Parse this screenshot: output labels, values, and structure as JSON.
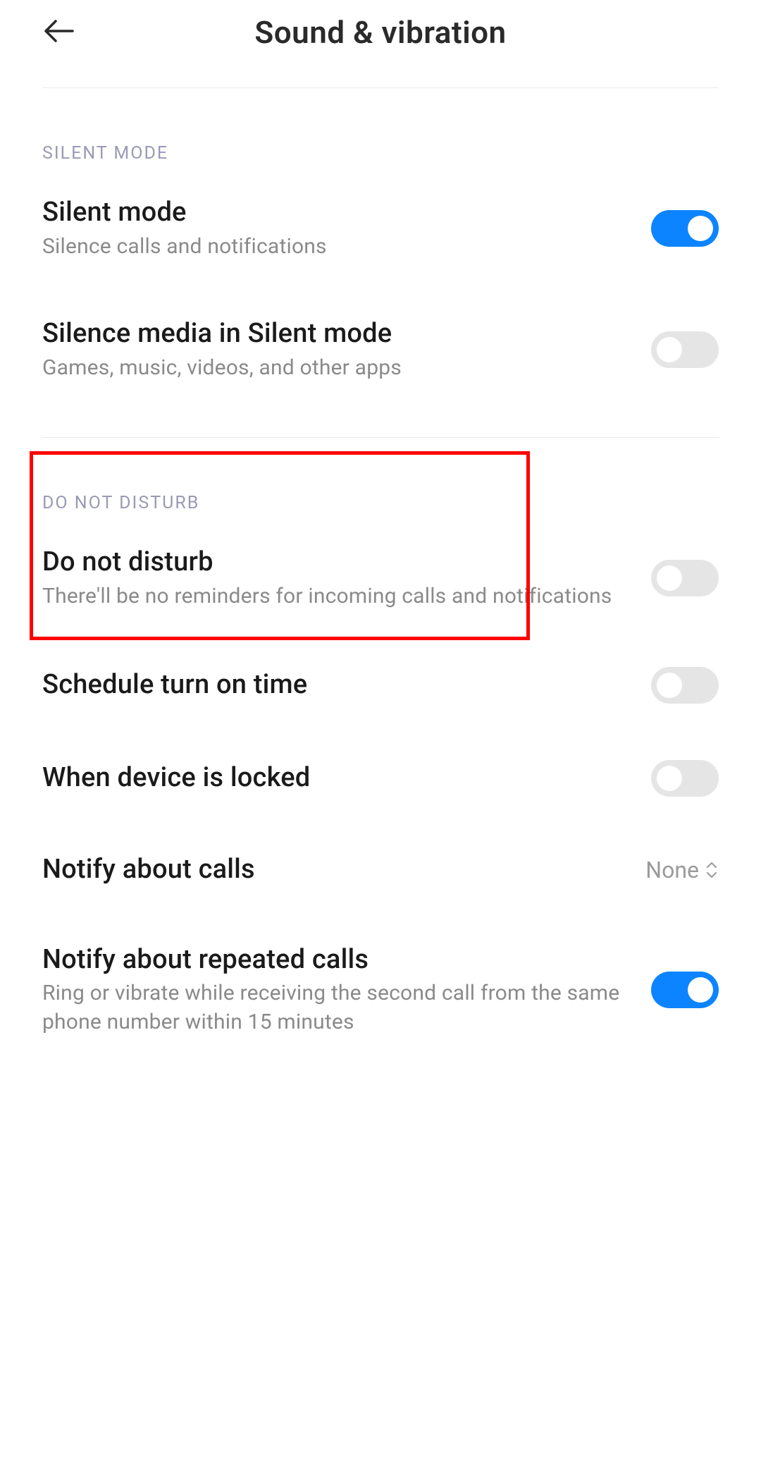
{
  "header": {
    "title": "Sound & vibration"
  },
  "sections": {
    "silent": {
      "header": "SILENT MODE",
      "silent_mode": {
        "title": "Silent mode",
        "subtitle": "Silence calls and notifications"
      },
      "silence_media": {
        "title": "Silence media in Silent mode",
        "subtitle": "Games, music, videos, and other apps"
      }
    },
    "dnd": {
      "header": "DO NOT DISTURB",
      "do_not_disturb": {
        "title": "Do not disturb",
        "subtitle": "There'll be no reminders for incoming calls and notifications"
      },
      "schedule": {
        "title": "Schedule turn on time"
      },
      "locked": {
        "title": "When device is locked"
      },
      "notify_calls": {
        "title": "Notify about calls",
        "value": "None"
      },
      "repeated": {
        "title": "Notify about repeated calls",
        "subtitle": "Ring or vibrate while receiving the second call from the same phone number within 15 minutes"
      }
    }
  }
}
